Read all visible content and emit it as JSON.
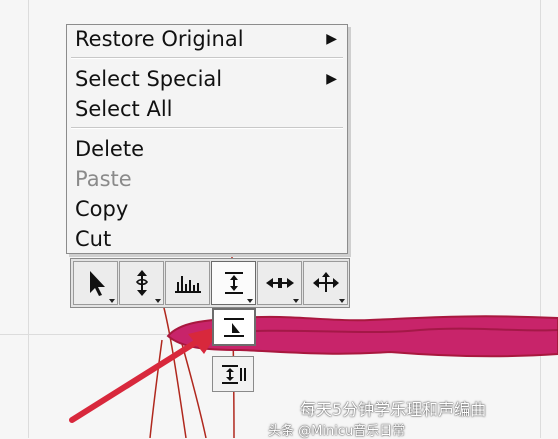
{
  "context_menu": {
    "items": [
      {
        "label": "Restore Original",
        "submenu": true,
        "enabled": true
      },
      {
        "label": "Select Special",
        "submenu": true,
        "enabled": true
      },
      {
        "label": "Select All",
        "submenu": false,
        "enabled": true
      },
      {
        "label": "Delete",
        "submenu": false,
        "enabled": true
      },
      {
        "label": "Paste",
        "submenu": false,
        "enabled": false
      },
      {
        "label": "Copy",
        "submenu": false,
        "enabled": true
      },
      {
        "label": "Cut",
        "submenu": false,
        "enabled": true
      }
    ],
    "submenu_arrow": "▶"
  },
  "toolbar": {
    "tools": [
      {
        "icon": "pointer-arrow-icon",
        "has_dropdown": true,
        "active": false
      },
      {
        "icon": "vertical-pitch-icon",
        "has_dropdown": true,
        "active": false
      },
      {
        "icon": "amplitude-bars-icon",
        "has_dropdown": false,
        "active": false
      },
      {
        "icon": "time-stretch-vertical-icon",
        "has_dropdown": true,
        "active": true
      },
      {
        "icon": "horizontal-stretch-icon",
        "has_dropdown": true,
        "active": false
      },
      {
        "icon": "move-cross-icon",
        "has_dropdown": true,
        "active": false
      }
    ]
  },
  "flyout": {
    "items": [
      {
        "icon": "time-handle-icon",
        "selected": true
      },
      {
        "icon": "time-handle-pause-icon",
        "selected": false
      }
    ]
  },
  "watermark": {
    "line1": "每天5分钟学乐理和声编曲",
    "line2": "头条 @Minicu音乐日常"
  },
  "colors": {
    "blob_fill": "#c8246a",
    "blob_edge": "#a8183e",
    "arrow": "#d8283c",
    "trace": "#b0281e"
  }
}
